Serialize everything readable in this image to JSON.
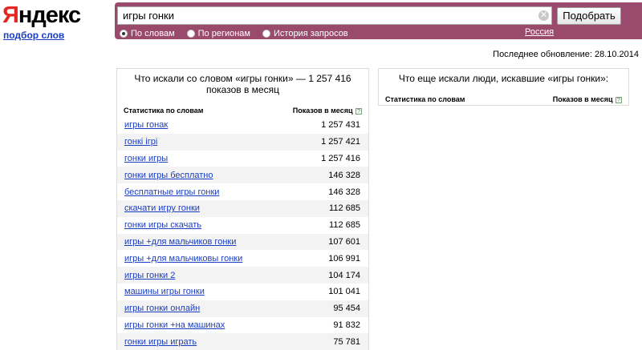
{
  "logo": {
    "first_letter": "Я",
    "rest": "ндекс",
    "subtitle": "подбор слов"
  },
  "search": {
    "value": "игры гонки",
    "button_label": "Подобрать",
    "clear_icon": "✕"
  },
  "search_modes": [
    {
      "label": "По словам",
      "checked": true
    },
    {
      "label": "По регионам",
      "checked": false
    },
    {
      "label": "История запросов",
      "checked": false
    }
  ],
  "region_link": "Россия",
  "last_update": "Последнее обновление: 28.10.2014",
  "left_panel": {
    "title": "Что искали со словом «игры гонки» — 1 257 416 показов в месяц",
    "col_phrase": "Статистика по словам",
    "col_count": "Показов в месяц",
    "help": "?",
    "rows": [
      {
        "phrase": "игры гонак",
        "count": "1 257 431"
      },
      {
        "phrase": "гонкі ігрі",
        "count": "1 257 421"
      },
      {
        "phrase": "гонки игры",
        "count": "1 257 416"
      },
      {
        "phrase": "гонки игры бесплатно",
        "count": "146 328"
      },
      {
        "phrase": "бесплатные игры гонки",
        "count": "146 328"
      },
      {
        "phrase": "скачати игру гонки",
        "count": "112 685"
      },
      {
        "phrase": "гонки игры скачать",
        "count": "112 685"
      },
      {
        "phrase": "игры +для мальчиков гонки",
        "count": "107 601"
      },
      {
        "phrase": "игры +для мальчиковы гонки",
        "count": "106 991"
      },
      {
        "phrase": "игры гонки 2",
        "count": "104 174"
      },
      {
        "phrase": "машины игры гонки",
        "count": "101 041"
      },
      {
        "phrase": "игры гонки онлайн",
        "count": "95 454"
      },
      {
        "phrase": "игры гонки +на машинах",
        "count": "91 832"
      },
      {
        "phrase": "гонки игры играть",
        "count": "75 781"
      }
    ]
  },
  "right_panel": {
    "title": "Что еще искали люди, искавшие «игры гонки»:",
    "col_phrase": "Статистика по словам",
    "col_count": "Показов в месяц",
    "help": "?"
  },
  "colors": {
    "search_bar": "#9a4a6c",
    "link": "#1a3dc1",
    "logo_red": "#e52620"
  }
}
